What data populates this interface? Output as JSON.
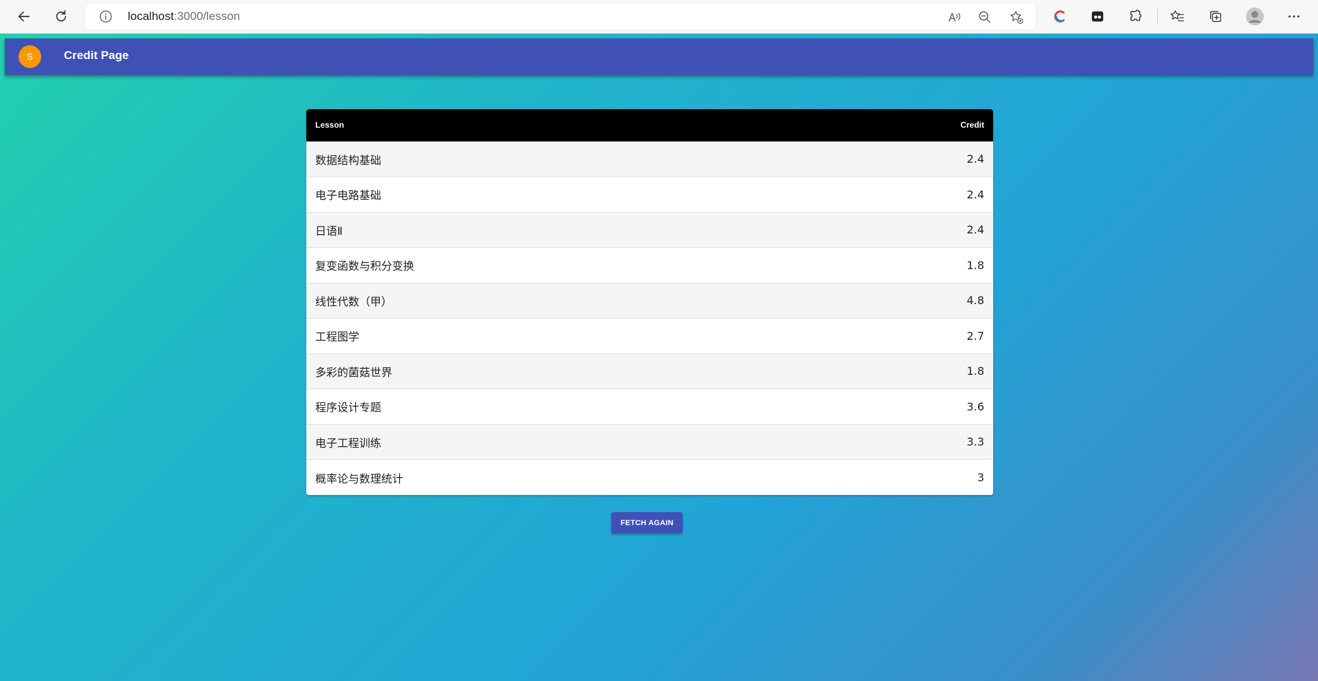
{
  "browser": {
    "url_host": "localhost",
    "url_path": ":3000/lesson"
  },
  "appbar": {
    "avatar_letter": "S",
    "title": "Credit Page"
  },
  "table": {
    "headers": {
      "lesson": "Lesson",
      "credit": "Credit"
    },
    "rows": [
      {
        "lesson": "数据结构基础",
        "credit": "2.4"
      },
      {
        "lesson": "电子电路基础",
        "credit": "2.4"
      },
      {
        "lesson": "日语Ⅱ",
        "credit": "2.4"
      },
      {
        "lesson": "复变函数与积分变换",
        "credit": "1.8"
      },
      {
        "lesson": "线性代数（甲）",
        "credit": "4.8"
      },
      {
        "lesson": "工程图学",
        "credit": "2.7"
      },
      {
        "lesson": "多彩的菌菇世界",
        "credit": "1.8"
      },
      {
        "lesson": "程序设计专题",
        "credit": "3.6"
      },
      {
        "lesson": "电子工程训练",
        "credit": "3.3"
      },
      {
        "lesson": "概率论与数理统计",
        "credit": "3"
      }
    ]
  },
  "actions": {
    "fetch_label": "FETCH AGAIN"
  },
  "colors": {
    "appbar": "#3f51b5",
    "avatar": "#ff9800",
    "table_header": "#000000",
    "button": "#3f51b5"
  }
}
